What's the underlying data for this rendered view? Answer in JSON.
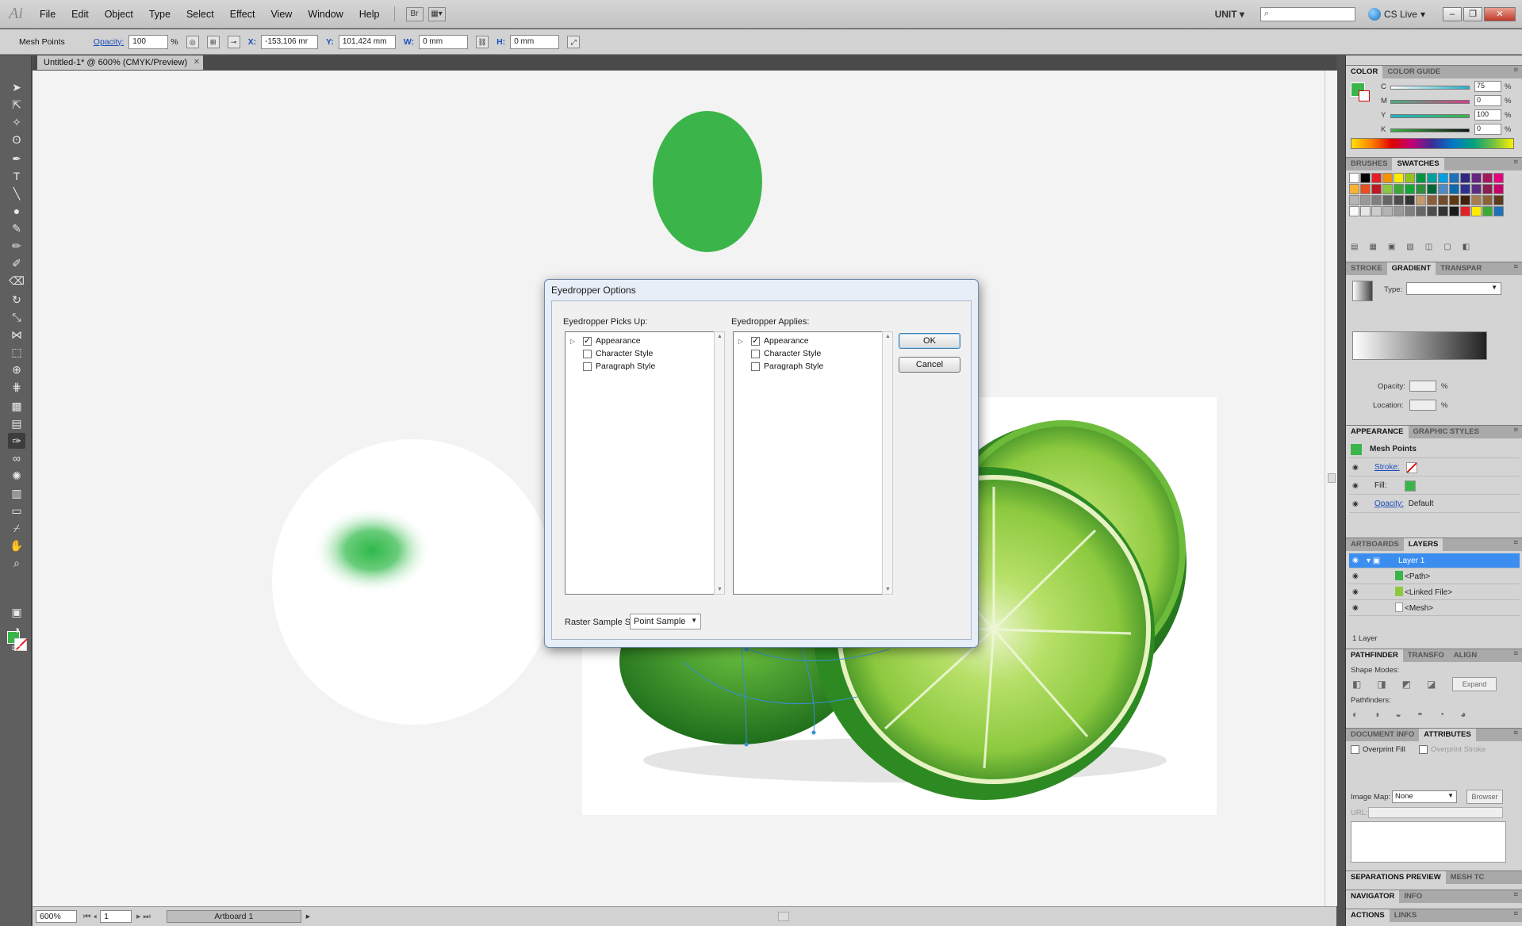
{
  "app": {
    "logo": "Ai",
    "menus": [
      "File",
      "Edit",
      "Object",
      "Type",
      "Select",
      "Effect",
      "View",
      "Window",
      "Help"
    ],
    "workspace": "UNIT",
    "cs_live": "CS Live"
  },
  "control_bar": {
    "selection": "Mesh Points",
    "opacity_label": "Opacity:",
    "opacity_value": "100",
    "opacity_unit": "%",
    "x_label": "X:",
    "x_value": "-153,106 mr",
    "y_label": "Y:",
    "y_value": "101,424 mm",
    "w_label": "W:",
    "w_value": "0 mm",
    "h_label": "H:",
    "h_value": "0 mm"
  },
  "document": {
    "tab_title": "Untitled-1* @ 600% (CMYK/Preview)",
    "zoom": "600%",
    "artboard_number": "1",
    "artboard_name": "Artboard 1"
  },
  "dialog": {
    "title": "Eyedropper Options",
    "picks_up_label": "Eyedropper Picks Up:",
    "applies_label": "Eyedropper Applies:",
    "picks_up_items": [
      {
        "label": "Appearance",
        "checked": true
      },
      {
        "label": "Character Style",
        "checked": false
      },
      {
        "label": "Paragraph Style",
        "checked": false
      }
    ],
    "applies_items": [
      {
        "label": "Appearance",
        "checked": true
      },
      {
        "label": "Character Style",
        "checked": false
      },
      {
        "label": "Paragraph Style",
        "checked": false
      }
    ],
    "ok_label": "OK",
    "cancel_label": "Cancel",
    "raster_label": "Raster Sample Size:",
    "raster_value": "Point Sample"
  },
  "panels": {
    "color": {
      "tabs": [
        "COLOR",
        "COLOR GUIDE"
      ],
      "channels": [
        {
          "label": "C",
          "value": "75",
          "color": "#23b0c8"
        },
        {
          "label": "M",
          "value": "0",
          "color": "#d93a8a"
        },
        {
          "label": "Y",
          "value": "100",
          "color": "#e2d21c"
        },
        {
          "label": "K",
          "value": "0",
          "color": "#222222"
        }
      ],
      "unit": "%",
      "fill": "#3bb54a"
    },
    "swatches_tabs": [
      "BRUSHES",
      "SWATCHES"
    ],
    "gradient": {
      "tabs": [
        "STROKE",
        "GRADIENT",
        "TRANSPAR"
      ],
      "type_label": "Type:",
      "opacity_label": "Opacity:",
      "location_label": "Location:",
      "unit": "%"
    },
    "appearance": {
      "tabs": [
        "APPEARANCE",
        "GRAPHIC STYLES"
      ],
      "title": "Mesh Points",
      "stroke_label": "Stroke:",
      "fill_label": "Fill:",
      "opacity_label": "Opacity:",
      "opacity_value": "Default"
    },
    "layers": {
      "tabs": [
        "ARTBOARDS",
        "LAYERS"
      ],
      "rows": [
        "Layer 1",
        "<Path>",
        "<Linked File>",
        "<Mesh>"
      ],
      "count": "1 Layer"
    },
    "pathfinder": {
      "tabs": [
        "PATHFINDER",
        "TRANSFO",
        "ALIGN"
      ],
      "shape_modes": "Shape Modes:",
      "expand": "Expand",
      "pathfinders": "Pathfinders:"
    },
    "attributes": {
      "tabs": [
        "DOCUMENT INFO",
        "ATTRIBUTES"
      ],
      "overprint_fill": "Overprint Fill",
      "overprint_stroke": "Overprint Stroke",
      "image_map_label": "Image Map:",
      "image_map_value": "None",
      "browser": "Browser",
      "url_label": "URL:"
    },
    "bottom_tabs": [
      [
        "SEPARATIONS PREVIEW",
        "MESH TC"
      ],
      [
        "NAVIGATOR",
        "INFO"
      ],
      [
        "ACTIONS",
        "LINKS"
      ]
    ]
  }
}
